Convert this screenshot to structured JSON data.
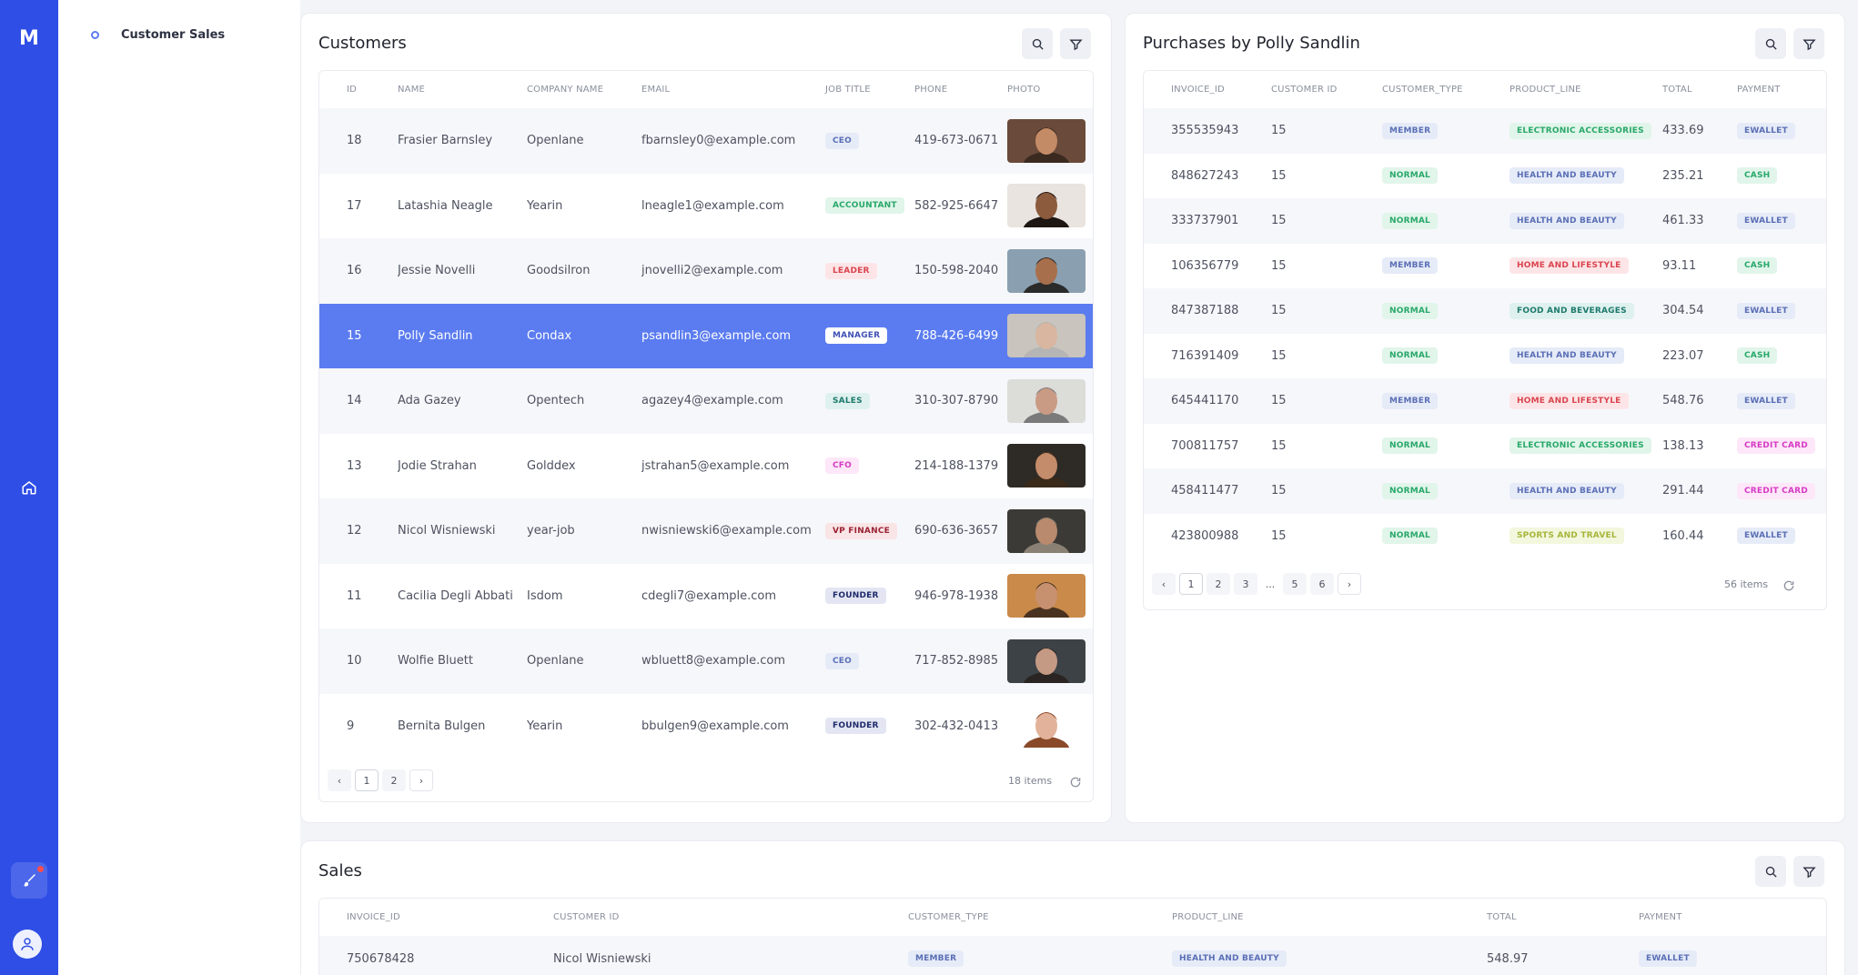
{
  "app": {
    "logo": "M"
  },
  "menu": {
    "item_label": "Customer Sales"
  },
  "customers": {
    "title": "Customers",
    "columns": [
      "ID",
      "NAME",
      "COMPANY NAME",
      "EMAIL",
      "JOB TITLE",
      "PHONE",
      "PHOTO"
    ],
    "rows": [
      {
        "id": "18",
        "name": "Frasier Barnsley",
        "company": "Openlane",
        "email": "fbarnsley0@example.com",
        "job": "CEO",
        "job_color": "gray",
        "phone": "419-673-0671",
        "photo": "woman-smiling"
      },
      {
        "id": "17",
        "name": "Latashia Neagle",
        "company": "Yearin",
        "email": "lneagle1@example.com",
        "job": "ACCOUNTANT",
        "job_color": "green",
        "phone": "582-925-6647",
        "photo": "woman-glasses"
      },
      {
        "id": "16",
        "name": "Jessie Novelli",
        "company": "Goodsilron",
        "email": "jnovelli2@example.com",
        "job": "LEADER",
        "job_color": "red",
        "phone": "150-598-2040",
        "photo": "man-laughing"
      },
      {
        "id": "15",
        "name": "Polly Sandlin",
        "company": "Condax",
        "email": "psandlin3@example.com",
        "job": "MANAGER",
        "job_color": "white",
        "phone": "788-426-6499",
        "photo": "older-man"
      },
      {
        "id": "14",
        "name": "Ada Gazey",
        "company": "Opentech",
        "email": "agazey4@example.com",
        "job": "SALES",
        "job_color": "teal",
        "phone": "310-307-8790",
        "photo": "man-glasses"
      },
      {
        "id": "13",
        "name": "Jodie Strahan",
        "company": "Golddex",
        "email": "jstrahan5@example.com",
        "job": "CFO",
        "job_color": "pink",
        "phone": "214-188-1379",
        "photo": "man-glasses-dark"
      },
      {
        "id": "12",
        "name": "Nicol Wisniewski",
        "company": "year-job",
        "email": "nwisniewski6@example.com",
        "job": "VP FINANCE",
        "job_color": "maroon",
        "phone": "690-636-3657",
        "photo": "older-man-beard"
      },
      {
        "id": "11",
        "name": "Cacilia Degli Abbati",
        "company": "Isdom",
        "email": "cdegli7@example.com",
        "job": "FOUNDER",
        "job_color": "navy",
        "phone": "946-978-1938",
        "photo": "woman-curly"
      },
      {
        "id": "10",
        "name": "Wolfie Bluett",
        "company": "Openlane",
        "email": "wbluett8@example.com",
        "job": "CEO",
        "job_color": "gray",
        "phone": "717-852-8985",
        "photo": "man-portrait"
      },
      {
        "id": "9",
        "name": "Bernita Bulgen",
        "company": "Yearin",
        "email": "bbulgen9@example.com",
        "job": "FOUNDER",
        "job_color": "navy",
        "phone": "302-432-0413",
        "photo": "woman-smiling-white"
      }
    ],
    "pager": {
      "prev": "‹",
      "pages": [
        "1",
        "2"
      ],
      "next": "›",
      "active": "1"
    },
    "items_count": "18 items"
  },
  "purchases": {
    "title": "Purchases by Polly Sandlin",
    "columns": [
      "INVOICE_ID",
      "CUSTOMER ID",
      "CUSTOMER_TYPE",
      "PRODUCT_LINE",
      "TOTAL",
      "PAYMENT"
    ],
    "rows": [
      {
        "invoice": "355535943",
        "customer": "15",
        "type": "MEMBER",
        "type_color": "gray",
        "product": "ELECTRONIC ACCESSORIES",
        "product_color": "green",
        "total": "433.69",
        "payment": "EWALLET",
        "payment_color": "gray"
      },
      {
        "invoice": "848627243",
        "customer": "15",
        "type": "NORMAL",
        "type_color": "green",
        "product": "HEALTH AND BEAUTY",
        "product_color": "gray",
        "total": "235.21",
        "payment": "CASH",
        "payment_color": "green"
      },
      {
        "invoice": "333737901",
        "customer": "15",
        "type": "NORMAL",
        "type_color": "green",
        "product": "HEALTH AND BEAUTY",
        "product_color": "gray",
        "total": "461.33",
        "payment": "EWALLET",
        "payment_color": "gray"
      },
      {
        "invoice": "106356779",
        "customer": "15",
        "type": "MEMBER",
        "type_color": "gray",
        "product": "HOME AND LIFESTYLE",
        "product_color": "red",
        "total": "93.11",
        "payment": "CASH",
        "payment_color": "green"
      },
      {
        "invoice": "847387188",
        "customer": "15",
        "type": "NORMAL",
        "type_color": "green",
        "product": "FOOD AND BEVERAGES",
        "product_color": "teal",
        "total": "304.54",
        "payment": "EWALLET",
        "payment_color": "gray"
      },
      {
        "invoice": "716391409",
        "customer": "15",
        "type": "NORMAL",
        "type_color": "green",
        "product": "HEALTH AND BEAUTY",
        "product_color": "gray",
        "total": "223.07",
        "payment": "CASH",
        "payment_color": "green"
      },
      {
        "invoice": "645441170",
        "customer": "15",
        "type": "MEMBER",
        "type_color": "gray",
        "product": "HOME AND LIFESTYLE",
        "product_color": "red",
        "total": "548.76",
        "payment": "EWALLET",
        "payment_color": "gray"
      },
      {
        "invoice": "700811757",
        "customer": "15",
        "type": "NORMAL",
        "type_color": "green",
        "product": "ELECTRONIC ACCESSORIES",
        "product_color": "green",
        "total": "138.13",
        "payment": "CREDIT CARD",
        "payment_color": "pink"
      },
      {
        "invoice": "458411477",
        "customer": "15",
        "type": "NORMAL",
        "type_color": "green",
        "product": "HEALTH AND BEAUTY",
        "product_color": "gray",
        "total": "291.44",
        "payment": "CREDIT CARD",
        "payment_color": "pink"
      },
      {
        "invoice": "423800988",
        "customer": "15",
        "type": "NORMAL",
        "type_color": "green",
        "product": "SPORTS AND TRAVEL",
        "product_color": "lime",
        "total": "160.44",
        "payment": "EWALLET",
        "payment_color": "gray"
      }
    ],
    "pager": {
      "prev": "‹",
      "pages": [
        "1",
        "2",
        "3",
        "...",
        "5",
        "6"
      ],
      "next": "›",
      "active": "1"
    },
    "items_count": "56 items"
  },
  "sales": {
    "title": "Sales",
    "columns": [
      "INVOICE_ID",
      "CUSTOMER ID",
      "CUSTOMER_TYPE",
      "PRODUCT_LINE",
      "TOTAL",
      "PAYMENT"
    ],
    "rows": [
      {
        "invoice": "750678428",
        "customer": "Nicol Wisniewski",
        "type": "MEMBER",
        "type_color": "gray",
        "product": "HEALTH AND BEAUTY",
        "product_color": "gray",
        "total": "548.97",
        "payment": "EWALLET",
        "payment_color": "gray"
      }
    ]
  },
  "colors": {
    "rail": "#2f4ee6",
    "selected_row": "#5b7cf0",
    "stripe": "#f6f7fa"
  },
  "icons": {
    "home": "home-icon",
    "brush": "brush-icon",
    "user": "user-icon",
    "search": "search-icon",
    "filter": "filter-icon",
    "refresh": "refresh-icon"
  }
}
